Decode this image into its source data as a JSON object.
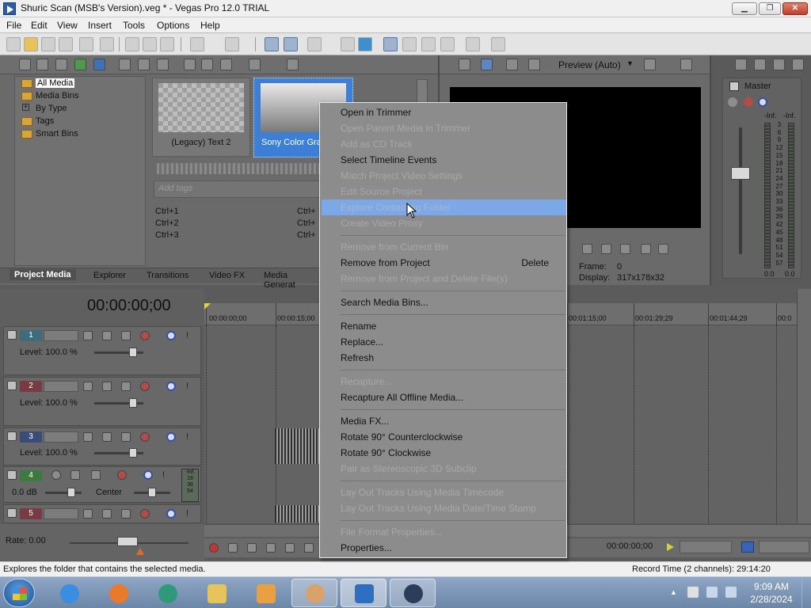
{
  "window": {
    "title": "Shuric Scan (MSB's Version).veg * - Vegas Pro 12.0 TRIAL",
    "minimize": "▁",
    "maximize": "❐",
    "close": "✕"
  },
  "menubar": [
    "File",
    "Edit",
    "View",
    "Insert",
    "Tools",
    "Options",
    "Help"
  ],
  "media_tree": {
    "items": [
      "All Media",
      "Media Bins",
      "By Type",
      "Tags",
      "Smart Bins"
    ],
    "selected": "All Media",
    "expander": "+"
  },
  "media_thumbs": [
    {
      "label": "(Legacy) Text 2"
    },
    {
      "label": "Sony Color Gra"
    }
  ],
  "tags": {
    "placeholder": "Add tags",
    "shortcuts_left": [
      "Ctrl+1",
      "Ctrl+2",
      "Ctrl+3"
    ],
    "shortcuts_right": [
      "Ctrl+",
      "Ctrl+",
      "Ctrl+"
    ]
  },
  "bottom_tabs": [
    "Project Media",
    "Explorer",
    "Transitions",
    "Video FX",
    "Media Generat"
  ],
  "active_tab": "Project Media",
  "preview": {
    "mode": "Preview (Auto)",
    "frame_label": "Frame:",
    "frame_value": "0",
    "display_label": "Display:",
    "display_value": "317x178x32"
  },
  "master": {
    "title": "Master",
    "left_inf": "-Inf.",
    "right_inf": "-Inf.",
    "scale": [
      "3",
      "6",
      "9",
      "12",
      "15",
      "18",
      "21",
      "24",
      "27",
      "30",
      "33",
      "36",
      "39",
      "42",
      "45",
      "48",
      "51",
      "54",
      "57"
    ],
    "left_value": "0.0",
    "right_value": "0.0"
  },
  "timeline": {
    "timecode": "00:00:00;00",
    "ruler": [
      "00:00:00;00",
      "00:00:15;00",
      "00:01:15;00",
      "00:01:29;29",
      "00:01:44;29",
      "00:0"
    ],
    "rate": "Rate: 0.00",
    "cursor_time": "00:00:00;00"
  },
  "tracks": [
    {
      "num": "1",
      "color": "#3d6d7d",
      "level": "Level: 100.0 %"
    },
    {
      "num": "2",
      "color": "#7a3a45",
      "level": "Level: 100.0 %"
    },
    {
      "num": "3",
      "color": "#3a4d7a",
      "level": "Level: 100.0 %"
    },
    {
      "num": "4",
      "color": "#3d7a3d",
      "volume": "0.0 dB",
      "pan": "Center",
      "meter": [
        "-Inf.",
        "18",
        "36",
        "54"
      ]
    },
    {
      "num": "5",
      "color": "#7a3a45"
    }
  ],
  "context_menu": {
    "items": [
      {
        "label": "Open in Trimmer",
        "enabled": true
      },
      {
        "label": "Open Parent Media in Trimmer",
        "enabled": false
      },
      {
        "label": "Add as CD Track",
        "enabled": false
      },
      {
        "label": "Select Timeline Events",
        "enabled": true
      },
      {
        "label": "Match Project Video Settings",
        "enabled": false
      },
      {
        "label": "Edit Source Project",
        "enabled": false
      },
      {
        "label": "Explore Containing Folder",
        "enabled": false,
        "highlighted": true
      },
      {
        "label": "Create Video Proxy",
        "enabled": false
      },
      {
        "label": "Remove from Current Bin",
        "enabled": false
      },
      {
        "label": "Remove from Project",
        "enabled": true,
        "shortcut": "Delete"
      },
      {
        "label": "Remove from Project and Delete File(s)",
        "enabled": false
      },
      {
        "label": "Search Media Bins...",
        "enabled": true
      },
      {
        "label": "Rename",
        "enabled": true
      },
      {
        "label": "Replace...",
        "enabled": true
      },
      {
        "label": "Refresh",
        "enabled": true
      },
      {
        "label": "Recapture...",
        "enabled": false
      },
      {
        "label": "Recapture All Offline Media...",
        "enabled": true
      },
      {
        "label": "Media FX...",
        "enabled": true
      },
      {
        "label": "Rotate 90° Counterclockwise",
        "enabled": true
      },
      {
        "label": "Rotate 90° Clockwise",
        "enabled": true
      },
      {
        "label": "Pair as Stereoscopic 3D Subclip",
        "enabled": false
      },
      {
        "label": "Lay Out Tracks Using Media Timecode",
        "enabled": false
      },
      {
        "label": "Lay Out Tracks Using Media Date/Time Stamp",
        "enabled": false
      },
      {
        "label": "File Format Properties...",
        "enabled": false
      },
      {
        "label": "Properties...",
        "enabled": true
      }
    ]
  },
  "status_bar": {
    "message": "Explores the folder that contains the selected media.",
    "record_time": "Record Time (2 channels): 29:14:20"
  },
  "taskbar": {
    "time": "9:09 AM",
    "date": "2/28/2024",
    "tray_arrow": "▲"
  },
  "colors": {
    "menu_highlight": "#7da8e8",
    "selection_blue": "#3d7fd6",
    "panel_grey": "#6a6a6a"
  }
}
